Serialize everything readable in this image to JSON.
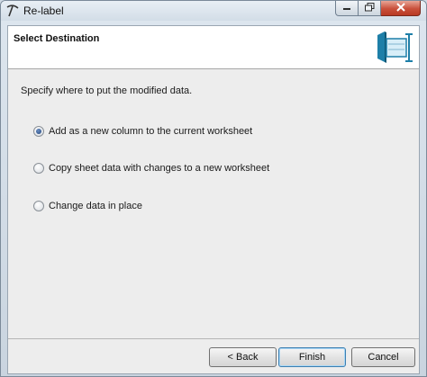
{
  "window": {
    "title": "Re-label"
  },
  "header": {
    "title": "Select Destination"
  },
  "content": {
    "instruction": "Specify where to put the modified data.",
    "options": [
      {
        "label": "Add as a new column to the current worksheet",
        "selected": true
      },
      {
        "label": "Copy sheet data with changes to a new worksheet",
        "selected": false
      },
      {
        "label": "Change data in place",
        "selected": false
      }
    ]
  },
  "footer": {
    "back_label": "< Back",
    "finish_label": "Finish",
    "cancel_label": "Cancel"
  },
  "icons": {
    "app": "pickaxe-icon",
    "header_graphic": "worksheet-destination-icon",
    "minimize": "minimize-icon",
    "maximize": "maximize-icon",
    "close": "close-icon"
  },
  "colors": {
    "accent": "#1e7fa8",
    "close_button": "#c9503a",
    "radio_selected": "#23457a"
  }
}
